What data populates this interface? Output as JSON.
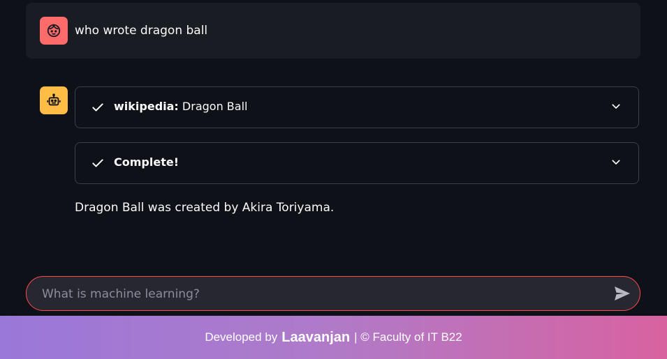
{
  "user_message": {
    "avatar_icon": "face-icon",
    "text": "who wrote dragon ball"
  },
  "assistant": {
    "avatar_icon": "robot-icon",
    "expanders": [
      {
        "prefix": "wikipedia:",
        "label": "Dragon Ball",
        "status_icon": "check-icon"
      },
      {
        "prefix": "Complete!",
        "label": "",
        "status_icon": "check-icon"
      }
    ],
    "answer": "Dragon Ball was created by Akira Toriyama."
  },
  "chat_input": {
    "placeholder": "What is machine learning?",
    "send_icon": "send-icon"
  },
  "footer": {
    "prefix": "Developed by",
    "author": "Laavanjan",
    "suffix": "| © Faculty of IT B22"
  },
  "colors": {
    "background": "#0e1117",
    "user_avatar": "#ff6b6b",
    "bot_avatar": "#ffbd45",
    "input_border": "#ff4b4b",
    "footer_gradient_start": "#9a78d9",
    "footer_gradient_end": "#d862a0"
  }
}
